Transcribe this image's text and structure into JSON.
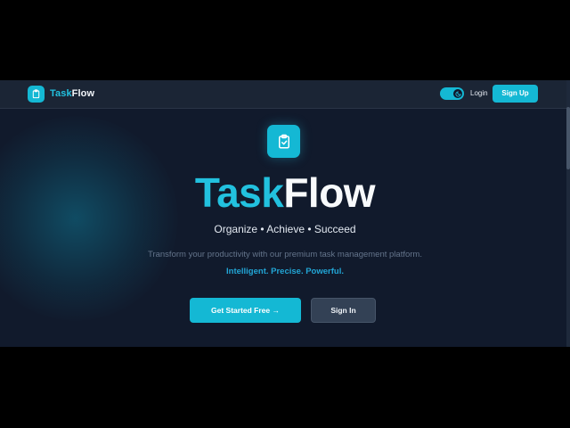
{
  "navbar": {
    "brand_part1": "Task",
    "brand_part2": "Flow",
    "login_label": "Login",
    "signup_label": "Sign Up",
    "theme_toggle": {
      "icon": "moon-icon",
      "state": "dark"
    }
  },
  "hero": {
    "icon": "clipboard-check-icon",
    "title_part1": "Task",
    "title_part2": "Flow",
    "tagline": "Organize • Achieve • Succeed",
    "description": "Transform your productivity with our premium task management platform.",
    "highlight": "Intelligent. Precise. Powerful.",
    "primary_cta": "Get Started Free →",
    "secondary_cta": "Sign In"
  },
  "colors": {
    "accent": "#14b8d4",
    "background": "#111a2c",
    "navbar": "#1b2535",
    "secondary_button": "#334155"
  }
}
